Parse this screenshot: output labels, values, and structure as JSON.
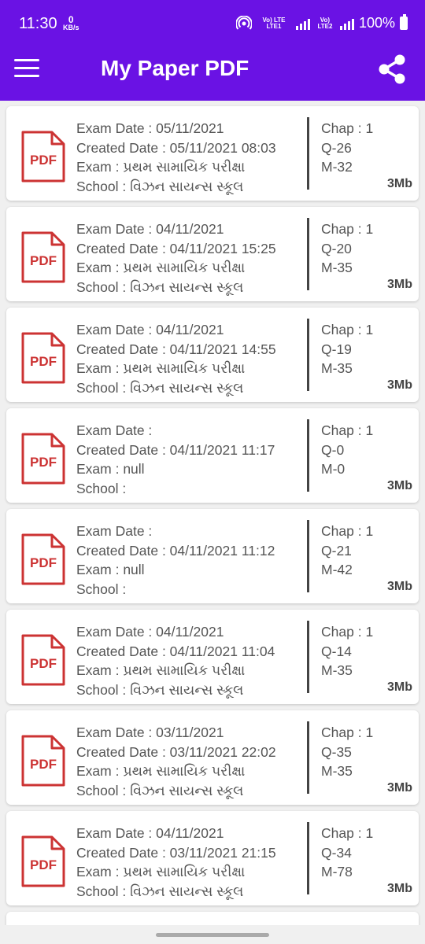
{
  "status_bar": {
    "time": "11:30",
    "net_speed_value": "0",
    "net_speed_unit": "KB/s",
    "sim1_label": "Vo) LTE LTE1",
    "sim2_label": "Vo) LTE2",
    "battery": "100%"
  },
  "app_bar": {
    "title": "My Paper PDF",
    "menu_icon": "hamburger-menu-icon",
    "share_icon": "share-icon"
  },
  "labels": {
    "exam_date": "Exam Date : ",
    "created_date": "Created Date : ",
    "exam": "Exam : ",
    "school": "School : ",
    "chap": "Chap : ",
    "pdf_badge": "PDF"
  },
  "colors": {
    "primary": "#6a12e4",
    "pdf_red": "#cc3333"
  },
  "papers": [
    {
      "exam_date": "05/11/2021",
      "created_date": "05/11/2021 08:03",
      "exam": "પ્રથમ સામાયિક પરીક્ષા",
      "school": "વિઝન સાયન્સ સ્કૂલ",
      "chap": "1",
      "q": "Q-26",
      "m": "M-32",
      "size": "3Mb"
    },
    {
      "exam_date": "04/11/2021",
      "created_date": "04/11/2021 15:25",
      "exam": "પ્રથમ સામાયિક પરીક્ષા",
      "school": "વિઝન સાયન્સ સ્કૂલ",
      "chap": "1",
      "q": "Q-20",
      "m": "M-35",
      "size": "3Mb"
    },
    {
      "exam_date": "04/11/2021",
      "created_date": "04/11/2021 14:55",
      "exam": "પ્રથમ સામાયિક પરીક્ષા",
      "school": "વિઝન સાયન્સ સ્કૂલ",
      "chap": "1",
      "q": "Q-19",
      "m": "M-35",
      "size": "3Mb"
    },
    {
      "exam_date": "",
      "created_date": "04/11/2021 11:17",
      "exam": "null",
      "school": "",
      "chap": "1",
      "q": "Q-0",
      "m": "M-0",
      "size": "3Mb"
    },
    {
      "exam_date": "",
      "created_date": "04/11/2021 11:12",
      "exam": "null",
      "school": "",
      "chap": "1",
      "q": "Q-21",
      "m": "M-42",
      "size": "3Mb"
    },
    {
      "exam_date": "04/11/2021",
      "created_date": "04/11/2021 11:04",
      "exam": "પ્રથમ સામાયિક પરીક્ષા",
      "school": "વિઝન સાયન્સ સ્કૂલ",
      "chap": "1",
      "q": "Q-14",
      "m": "M-35",
      "size": "3Mb"
    },
    {
      "exam_date": "03/11/2021",
      "created_date": "03/11/2021 22:02",
      "exam": "પ્રથમ સામાયિક પરીક્ષા",
      "school": "વિઝન સાયન્સ સ્કૂલ",
      "chap": "1",
      "q": "Q-35",
      "m": "M-35",
      "size": "3Mb"
    },
    {
      "exam_date": "04/11/2021",
      "created_date": "03/11/2021 21:15",
      "exam": "પ્રથમ સામાયિક પરીક્ષા",
      "school": "વિઝન સાયન્સ સ્કૂલ",
      "chap": "1",
      "q": "Q-34",
      "m": "M-78",
      "size": "3Mb"
    }
  ]
}
